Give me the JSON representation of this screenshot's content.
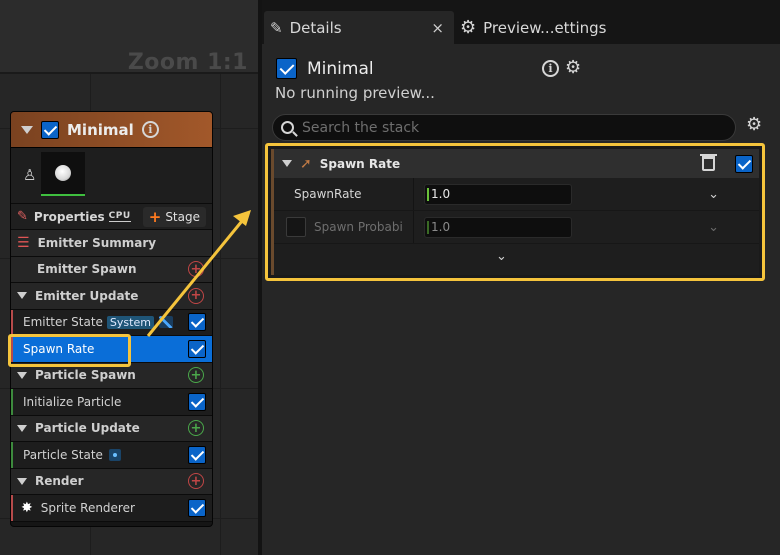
{
  "graph": {
    "zoom_label": "Zoom 1:1"
  },
  "node": {
    "title": "Minimal",
    "properties_label": "Properties",
    "cpu_label": "CPU",
    "stage_label": "Stage",
    "sections": {
      "emitter_summary": "Emitter Summary",
      "emitter_spawn": "Emitter Spawn",
      "emitter_update": "Emitter Update",
      "particle_spawn": "Particle Spawn",
      "particle_update": "Particle Update",
      "render": "Render"
    },
    "modules": {
      "emitter_state": "Emitter State",
      "emitter_state_tag": "System",
      "spawn_rate": "Spawn Rate",
      "initialize_particle": "Initialize Particle",
      "particle_state": "Particle State",
      "sprite_renderer": "Sprite Renderer"
    }
  },
  "details": {
    "tabs": [
      {
        "label": "Details",
        "close": "×"
      },
      {
        "label": "Preview...ettings"
      }
    ],
    "emitter_name": "Minimal",
    "status_text": "No running preview...",
    "search_placeholder": "Search the stack",
    "stack": {
      "module_title": "Spawn Rate",
      "rows": [
        {
          "label": "SpawnRate",
          "value": "1.0"
        },
        {
          "label": "Spawn Probabi",
          "value": "1.0"
        }
      ]
    }
  },
  "colors": {
    "accent_blue": "#0a64c8",
    "highlight_yellow": "#f5c43c",
    "node_header": "#a2582a"
  }
}
